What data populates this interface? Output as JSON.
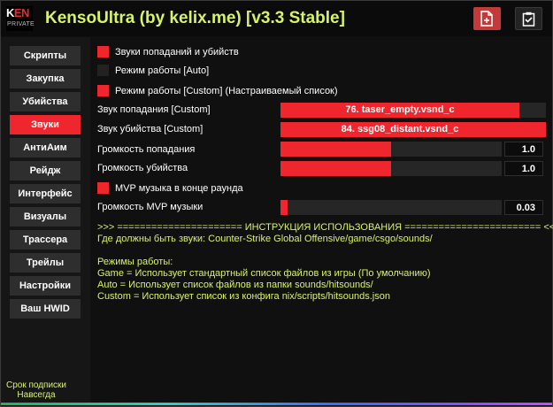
{
  "app": {
    "logo_main_k": "K",
    "logo_main_en": "EN",
    "logo_sub": "PRIVATE",
    "title": "KensoUltra (by kelix.me) [v3.3 Stable]"
  },
  "header_buttons": [
    {
      "icon": "document-add-icon"
    },
    {
      "icon": "clipboard-check-icon"
    }
  ],
  "sidebar": {
    "items": [
      {
        "label": "Скрипты"
      },
      {
        "label": "Закупка"
      },
      {
        "label": "Убийства"
      },
      {
        "label": "Звуки",
        "active": true
      },
      {
        "label": "АнтиАим"
      },
      {
        "label": "Рейдж"
      },
      {
        "label": "Интерфейс"
      },
      {
        "label": "Визуалы"
      },
      {
        "label": "Трассера"
      },
      {
        "label": "Трейлы"
      },
      {
        "label": "Настройки"
      },
      {
        "label": "Ваш HWID"
      }
    ],
    "subscription_label": "Срок подписки",
    "subscription_value": "Навсегда"
  },
  "sounds": {
    "hit_kill_sounds": {
      "label": "Звуки попаданий и убийств",
      "checked": true
    },
    "mode_auto": {
      "label": "Режим работы [Auto]",
      "checked": false
    },
    "mode_custom": {
      "label": "Режим работы [Custom] (Настраиваемый список)",
      "checked": true
    },
    "hit_sound": {
      "label": "Звук попадания [Custom]",
      "value": "76. taser_empty.vsnd_c",
      "fill_fraction": 0.9
    },
    "kill_sound": {
      "label": "Звук убийства [Custom]",
      "value": "84. ssg08_distant.vsnd_c",
      "fill_fraction": 1.0
    },
    "hit_volume": {
      "label": "Громкость попадания",
      "value": "1.0",
      "level": 0.5
    },
    "kill_volume": {
      "label": "Громкость убийства",
      "value": "1.0",
      "level": 0.5
    },
    "mvp_music": {
      "label": "MVP музыка в конце раунда",
      "checked": true
    },
    "mvp_volume": {
      "label": "Громкость MVP музыки",
      "value": "0.03",
      "level": 0.03
    }
  },
  "instructions": {
    "banner": ">>> ====================== ИНСТРУКЦИЯ ИСПОЛЬЗОВАНИЯ ======================== <<<",
    "path_line": "Где должны быть звуки: Counter-Strike Global Offensive/game/csgo/sounds/",
    "modes_title": "Режимы работы:",
    "mode_game": "Game = Использует стандартный список файлов из игры (По умолчанию)",
    "mode_auto": "Auto = Использует список файлов из папки sounds/hitsounds/",
    "mode_custom": "Custom = Использует список из конфига nix/scripts/hitsounds.json"
  },
  "colors": {
    "accent": "#f0262e",
    "title": "#d7f36a",
    "background": "#101010"
  }
}
